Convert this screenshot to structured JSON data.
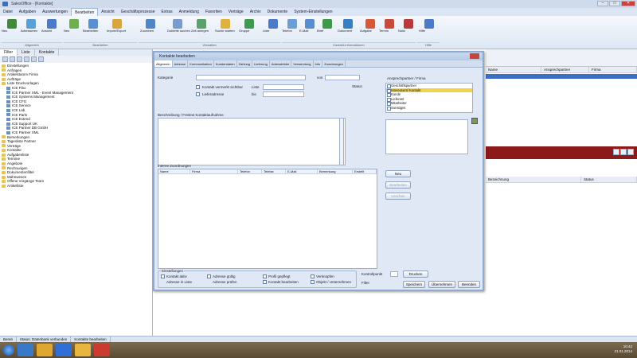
{
  "window": {
    "title": "SalesOffice - [Kontakte]"
  },
  "menu": {
    "tabs": [
      "Datei",
      "Aufgaben",
      "Auswertungen",
      "Bearbeiten",
      "Ansicht",
      "Geschäftsprozesse",
      "Extras",
      "Anmeldung",
      "Favoriten",
      "Verträge",
      "Archiv",
      "Dokumente",
      "System-Einstellungen"
    ],
    "active_index": 3
  },
  "ribbon": {
    "groups": [
      "Allgemein",
      "Bearbeiten",
      "Verwalten",
      "Kontakt-Informationen",
      "Hilfe"
    ],
    "buttons": [
      "Neu",
      "Adressieren",
      "Ansicht",
      "Neu",
      "Bearbeiten",
      "Import/Export",
      "Zuordnen",
      "Dublette suchen",
      "Zeit anlegen",
      "Suche starten",
      "Gruppe",
      "Liste",
      "Telefon",
      "E-Mail",
      "Brief",
      "Dokument",
      "Aufgabe",
      "Termin",
      "Notiz",
      "Hilfe"
    ]
  },
  "left_panel": {
    "tabs": [
      "Filter",
      "Liste",
      "Kontakte"
    ],
    "tree": [
      "Einstellungen",
      "Anfragen",
      "Artikelstamm Firma",
      "Aufträge",
      "Liste Druckvorlagen",
      "ICE Fibo",
      "ICE Partner XML - Event Management",
      "ICE Systems Management",
      "ICE CFG",
      "ICE Service",
      "ICE Lab",
      "ICE Parts",
      "ICE Extend",
      "ICE Support UK",
      "ICE Partner DB GmbH",
      "ICE Partner XML",
      "Bemerkungen",
      "Tagesliste Partner",
      "Verträge",
      "Kontakte",
      "Aufgabenliste",
      "Termine",
      "Angebote",
      "Rechnungen",
      "Dokumentenfilter",
      "Mahnwesen",
      "Offene Vorgänge Team",
      "Artikelliste"
    ]
  },
  "right_pane": {
    "columns": [
      "Name",
      "Ansprechpartner",
      "Firma"
    ],
    "columns2": [
      "Bezeichnung",
      "Status"
    ]
  },
  "dialog": {
    "title": "Kontakte bearbeiten",
    "tabs": [
      "Allgemein",
      "Adresse",
      "Kommunikation",
      "Kundendaten",
      "Zahlung",
      "Lieferung",
      "Adressfelder",
      "Verwendung",
      "Info",
      "Zuordnungen"
    ],
    "active_tab": 0,
    "labels": {
      "kategorie": "Kategorie",
      "von": "von",
      "status": "Status",
      "check1": "Kontakt vermerkt sichtbar",
      "check2": "Lieferadresse",
      "liste": "Liste",
      "bis": "bis",
      "text_section": "Beschreibung / Freitext Kontaktaufnahme",
      "right_top": "Ansprechpartner / Firma",
      "grid_section": "Interne Zuordnungen",
      "settings": "Einstellungen",
      "kontrollpunkt": "Kontrollpunkt",
      "cb1": "Kontakt aktiv",
      "cb2": "Adresse in Liste",
      "cb3": "Adresse gültig",
      "cb4": "Adresse prüfen",
      "cb5": "Profil gepflegt",
      "cb6": "Kontakt bearbeiten",
      "cb7": "Verknüpfen",
      "cb8": "Objekt / Unternehmen",
      "filter": "Filter"
    },
    "listbox_items": [
      "Geschäftspartner",
      "Interessent/ Kontakt",
      "Kunde",
      "Lieferant",
      "Mitarbeiter",
      "Sonstiges"
    ],
    "listbox_selected": 1,
    "grid_columns": [
      "Name",
      "Firma",
      "Telefon",
      "Telefax",
      "E-Mail",
      "Bemerkung",
      "Erstellt"
    ],
    "side_buttons": [
      "Neu",
      "Bearbeiten",
      "Löschen"
    ],
    "bottom_buttons": [
      "Drucken",
      "Speichern",
      "Übernehmen",
      "Beenden"
    ]
  },
  "statusbar": [
    "Bereit",
    "Status: Datenbank verbunden",
    "Kontakte bearbeiten"
  ],
  "taskbar": {
    "time": "10:42",
    "date": "21.01.2014",
    "task": "Kontakte"
  }
}
